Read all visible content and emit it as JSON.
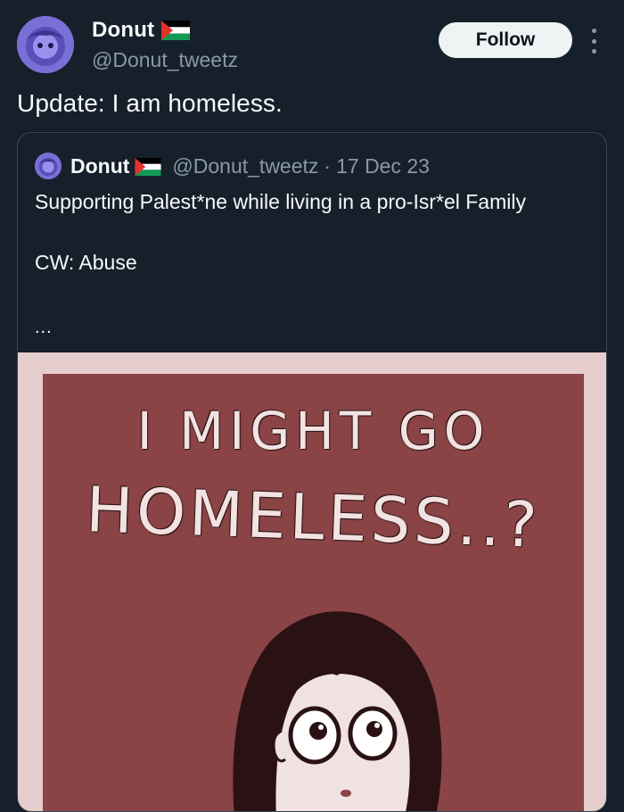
{
  "author": {
    "name": "Donut",
    "handle": "@Donut_tweetz",
    "flag_icon": "palestine-flag-icon"
  },
  "actions": {
    "follow_label": "Follow",
    "more_icon": "more-vertical-icon"
  },
  "tweet": {
    "text": "Update: I am homeless."
  },
  "quoted": {
    "name": "Donut",
    "handle": "@Donut_tweetz",
    "separator": "·",
    "date": "17 Dec 23",
    "body": "Supporting Palest*ne while living in a pro-Isr*el Family\n\nCW: Abuse",
    "ellipsis": "...",
    "image": {
      "line1": "I MIGHT GO",
      "line2": "HOMELESS..?"
    }
  },
  "colors": {
    "background": "#15202b",
    "text": "#f7f9f9",
    "secondary": "#8b98a5",
    "follow_bg": "#eff3f4",
    "comic_frame": "#e6cdcd",
    "comic_bg": "#8b4446"
  }
}
